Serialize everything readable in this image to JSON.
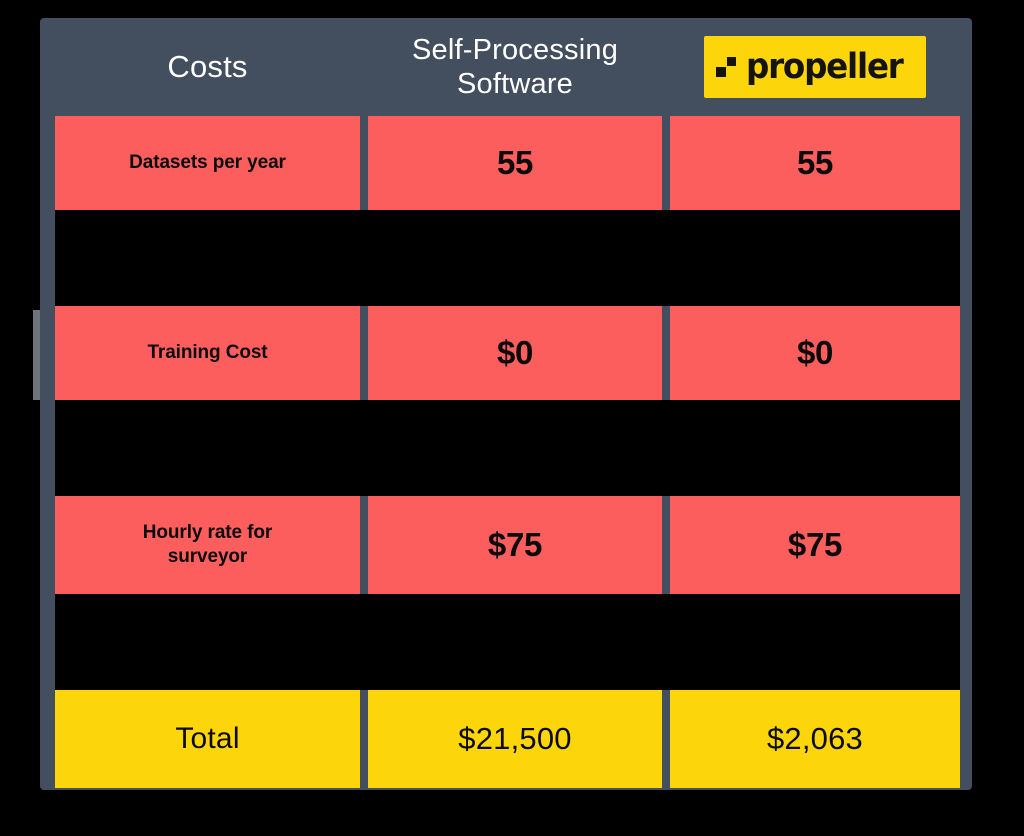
{
  "colors": {
    "page_background": "#000000",
    "panel": "#434e5e",
    "row_red": "#fc5d5d",
    "row_yellow": "#fcd60a",
    "header_text": "#ffffff",
    "cell_text": "#0b0b0b",
    "logo_background": "#fcd60a",
    "logo_text": "#15130f"
  },
  "header": {
    "col_label": "Costs",
    "col_two_line1": "Self-Processing",
    "col_two_line2": "Software",
    "col_three_logo": {
      "wordmark": "propeller",
      "mark_icon": "propeller-squares-icon"
    }
  },
  "chart_data": {
    "type": "table",
    "title": "Costs",
    "columns": [
      "Costs",
      "Self-Processing Software",
      "propeller"
    ],
    "rows": [
      {
        "label": "Datasets per year",
        "label_lines": [
          "Datasets per year"
        ],
        "self_processing": "55",
        "propeller": "55",
        "style": "red"
      },
      {
        "label": "Training Cost",
        "label_lines": [
          "Training Cost"
        ],
        "self_processing": "$0",
        "propeller": "$0",
        "style": "red"
      },
      {
        "label": "Hourly rate for surveyor",
        "label_lines": [
          "Hourly rate for",
          "surveyor"
        ],
        "self_processing": "$75",
        "propeller": "$75",
        "style": "red"
      },
      {
        "label": "Total",
        "label_lines": [
          "Total"
        ],
        "self_processing": "$21,500",
        "propeller": "$2,063",
        "style": "yellow"
      }
    ]
  }
}
